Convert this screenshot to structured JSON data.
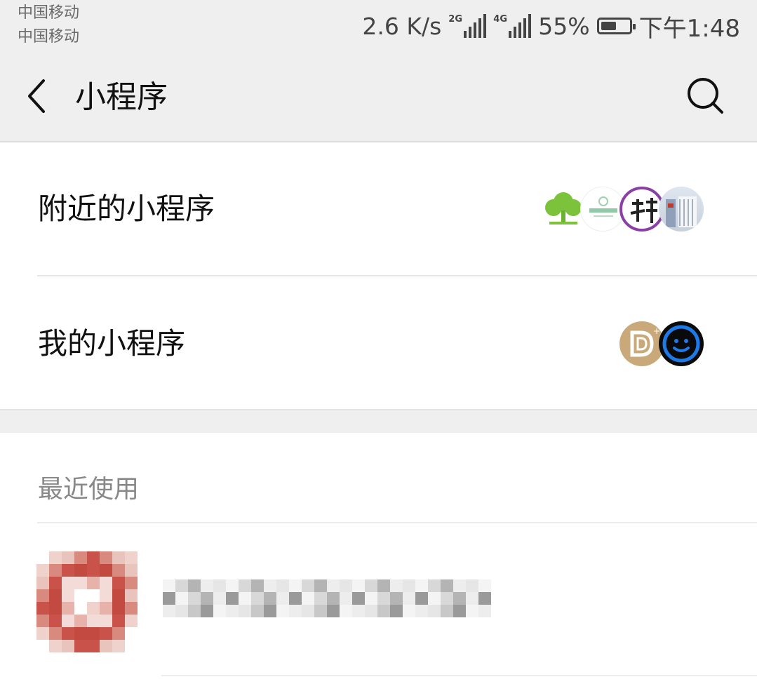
{
  "status_bar": {
    "carrier_1": "中国移动",
    "carrier_2": "中国移动",
    "network_speed": "2.6 K/s",
    "signal_1_type": "2G",
    "signal_2_type": "4G",
    "battery_percent": "55%",
    "battery_level": 0.55,
    "time": "下午1:48"
  },
  "nav": {
    "back_icon": "chevron-left-icon",
    "title": "小程序",
    "search_icon": "search-icon"
  },
  "nearby": {
    "label": "附近的小程序",
    "icons": [
      "tree-logo-icon",
      "green-tea-logo-icon",
      "purple-calligraphy-logo-icon",
      "building-photo-icon"
    ]
  },
  "mine": {
    "label": "我的小程序",
    "icons": [
      "gold-d-logo-icon",
      "blue-smiley-logo-icon"
    ]
  },
  "recent": {
    "section_label": "最近使用",
    "items": [
      {
        "avatar": "pixelated-avatar",
        "name": "pixelated-name"
      }
    ]
  },
  "colors": {
    "bar_bg": "#efefef",
    "text": "#111111",
    "muted": "#888888",
    "divider": "#e6e6e6"
  }
}
